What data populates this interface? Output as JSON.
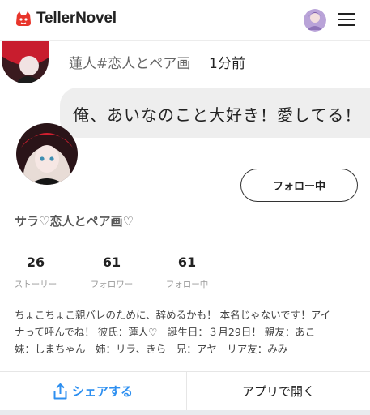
{
  "header": {
    "brand": "TellerNovel",
    "brand_color": "#e8352b"
  },
  "chat": {
    "speaker_name": "蓮人#恋人とペア画",
    "time": "1分前",
    "message": "俺、あいなのこと大好き！愛してる！"
  },
  "profile": {
    "follow_label": "フォロー中",
    "name": "サラ♡恋人とペア画♡",
    "stats": [
      {
        "value": "26",
        "label": "ストーリー"
      },
      {
        "value": "61",
        "label": "フォロワー"
      },
      {
        "value": "61",
        "label": "フォロー中"
      }
    ],
    "bio_lines": [
      "ちょこちょこ親バレのために、辞めるかも！ 本名じゃないです！アイ",
      "ナって呼んでね！ 彼氏：蓮人♡　誕生日：３月29日！ 親友：あこ",
      "妹：しまちゃん　姉：リラ、きら　兄：アヤ　リア友：みみ"
    ]
  },
  "actions": {
    "share_label": "シェアする",
    "open_label": "アプリで開く",
    "share_color": "#2d8ff0"
  }
}
